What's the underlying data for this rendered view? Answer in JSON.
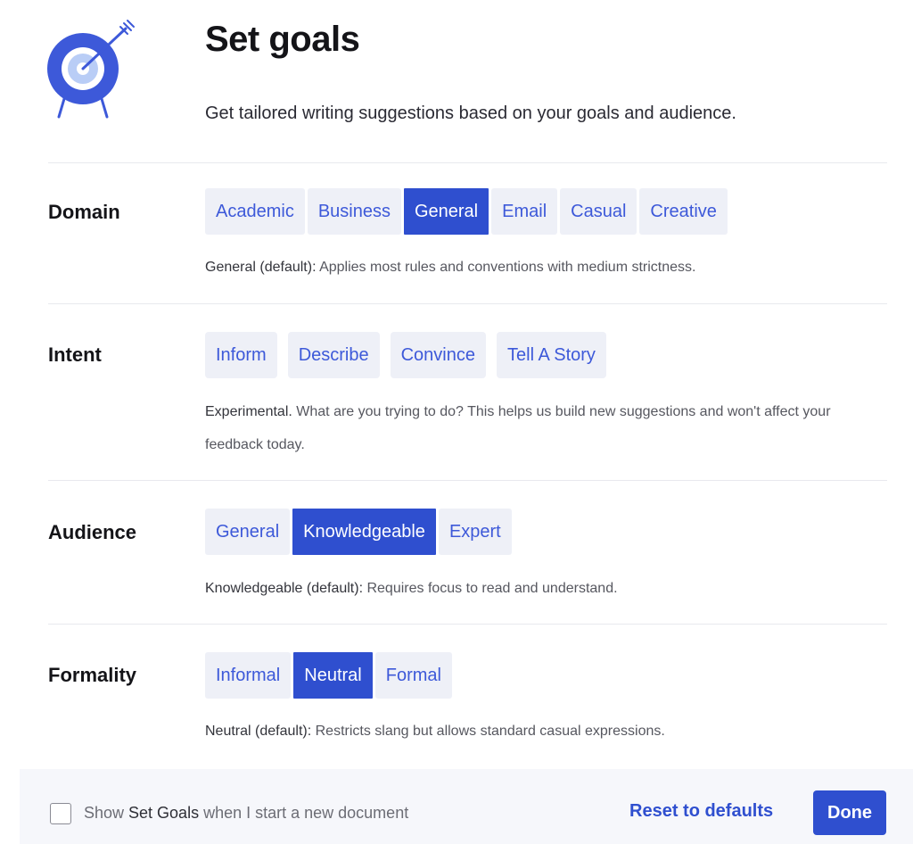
{
  "header": {
    "title": "Set goals",
    "subtitle": "Get tailored writing suggestions based on your goals and audience.",
    "logo_icon": "target-with-arrow-icon"
  },
  "colors": {
    "accent": "#2f4fcf",
    "segment_bg": "#eef0f7",
    "segment_text": "#3d59d9",
    "footer_bg": "#f6f7fb"
  },
  "domain": {
    "label": "Domain",
    "options": [
      "Academic",
      "Business",
      "General",
      "Email",
      "Casual",
      "Creative"
    ],
    "selected": "General",
    "desc_prefix": "General (default):",
    "desc_text": " Applies most rules and conventions with medium strictness."
  },
  "intent": {
    "label": "Intent",
    "options": [
      "Inform",
      "Describe",
      "Convince",
      "Tell A Story"
    ],
    "selected": null,
    "desc_prefix": "Experimental.",
    "desc_text": " What are you trying to do? This helps us build new suggestions and won't affect your feedback today."
  },
  "audience": {
    "label": "Audience",
    "options": [
      "General",
      "Knowledgeable",
      "Expert"
    ],
    "selected": "Knowledgeable",
    "desc_prefix": "Knowledgeable (default):",
    "desc_text": " Requires focus to read and understand."
  },
  "formality": {
    "label": "Formality",
    "options": [
      "Informal",
      "Neutral",
      "Formal"
    ],
    "selected": "Neutral",
    "desc_prefix": "Neutral (default):",
    "desc_text": " Restricts slang but allows standard casual expressions."
  },
  "footer": {
    "checkbox_checked": false,
    "checkbox_label_pre": "Show ",
    "checkbox_label_strong": "Set Goals",
    "checkbox_label_post": " when I start a new document",
    "reset_label": "Reset to defaults",
    "done_label": "Done"
  }
}
